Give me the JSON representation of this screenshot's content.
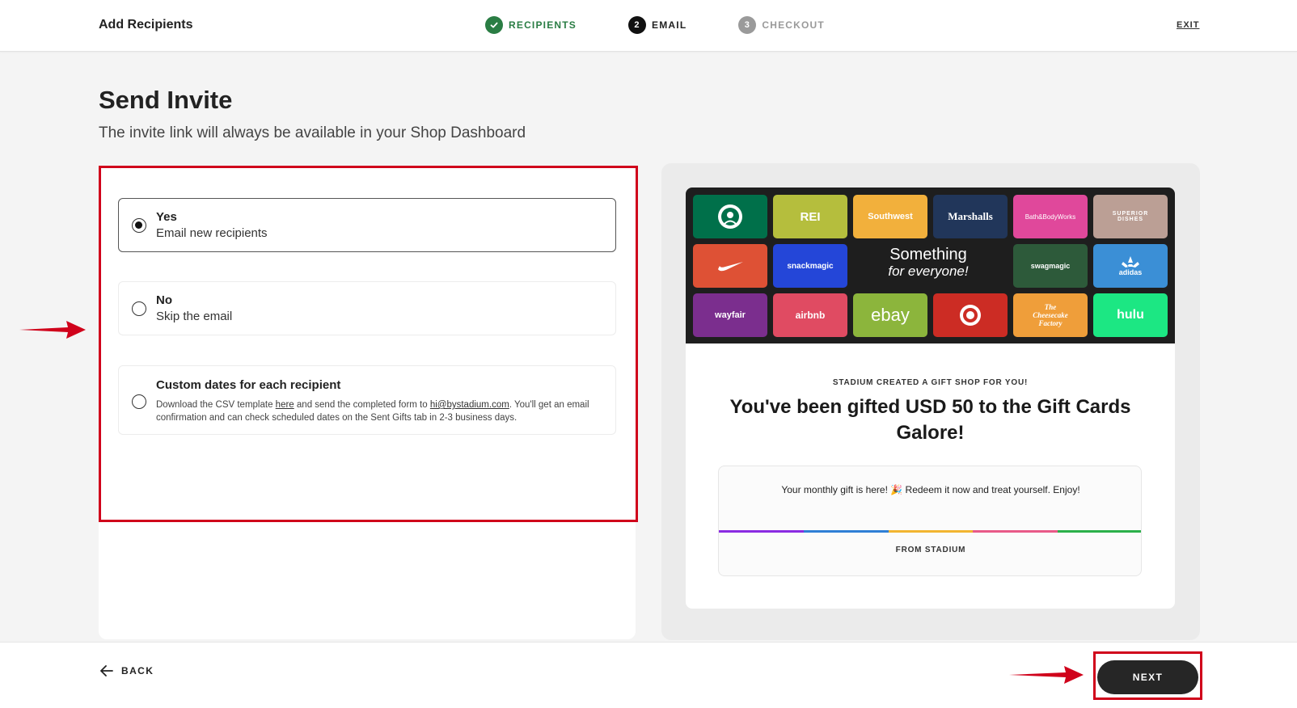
{
  "header": {
    "title": "Add Recipients",
    "steps": [
      {
        "num": "",
        "label": "RECIPIENTS",
        "state": "done"
      },
      {
        "num": "2",
        "label": "EMAIL",
        "state": "active"
      },
      {
        "num": "3",
        "label": "CHECKOUT",
        "state": "pending"
      }
    ],
    "exit_label": "EXIT"
  },
  "main": {
    "title": "Send Invite",
    "subtitle": "The invite link will always be available in your Shop Dashboard",
    "options": [
      {
        "title": "Yes",
        "desc": "Email new recipients",
        "selected": true
      },
      {
        "title": "No",
        "desc": "Skip the email",
        "selected": false
      },
      {
        "title": "Custom dates for each recipient",
        "desc_prefix": "Download the CSV template ",
        "link_here": "here",
        "desc_middle": " and send the completed form to ",
        "link_email": "hi@bystadium.com",
        "desc_suffix": ". You'll get an email confirmation and can check scheduled dates on the Sent Gifts tab in 2-3 business days.",
        "selected": false
      }
    ]
  },
  "preview": {
    "brands": [
      {
        "name": "",
        "icon": "starbucks-logo",
        "color": "#00704a"
      },
      {
        "name": "REI",
        "icon": "rei-logo",
        "color": "#b5be3d"
      },
      {
        "name": "Southwest",
        "icon": "southwest-logo",
        "color": "#f2b03c"
      },
      {
        "name": "Marshalls",
        "icon": "marshalls-logo",
        "color": "#21365a"
      },
      {
        "name": "Bath&BodyWorks",
        "icon": "bath-body-works-logo",
        "color": "#e0489b"
      },
      {
        "name": "SUPERIOR DISHES",
        "icon": "superior-dishes-logo",
        "color": "#bb9f95"
      },
      {
        "name": "",
        "icon": "nike-logo",
        "color": "#de5135"
      },
      {
        "name": "snackmagic",
        "icon": "snackmagic-logo",
        "color": "#2446d8"
      },
      {
        "name": "swagmagic",
        "icon": "swagmagic-logo",
        "color": "#2d5a3a"
      },
      {
        "name": "adidas",
        "icon": "adidas-logo",
        "color": "#3b8fd6"
      },
      {
        "name": "wayfair",
        "icon": "wayfair-logo",
        "color": "#7b2e8e"
      },
      {
        "name": "airbnb",
        "icon": "airbnb-logo",
        "color": "#e04b62"
      },
      {
        "name": "ebay",
        "icon": "ebay-logo",
        "color": "#8cb53c"
      },
      {
        "name": "",
        "icon": "target-logo",
        "color": "#cc2c24"
      },
      {
        "name": "The Cheesecake Factory",
        "icon": "cheesecake-factory-logo",
        "color": "#ef9e3a"
      },
      {
        "name": "hulu",
        "icon": "hulu-logo",
        "color": "#1ce783"
      }
    ],
    "something_line1": "Something",
    "something_line2": "for everyone!",
    "created_label": "STADIUM CREATED A GIFT SHOP FOR YOU!",
    "gift_title": "You've been gifted USD 50 to the Gift Cards Galore!",
    "message": "Your monthly gift is here! 🎉 Redeem it now and treat yourself. Enjoy!",
    "from_label": "FROM STADIUM",
    "rainbow_colors": [
      "#8a2be2",
      "#2f7fd6",
      "#f2b531",
      "#e85a88",
      "#2bb04a"
    ]
  },
  "footer": {
    "back_label": "BACK",
    "next_label": "NEXT"
  },
  "colors": {
    "accent_green": "#2a7d44",
    "annotation_red": "#d0021b",
    "next_button": "#262626"
  }
}
